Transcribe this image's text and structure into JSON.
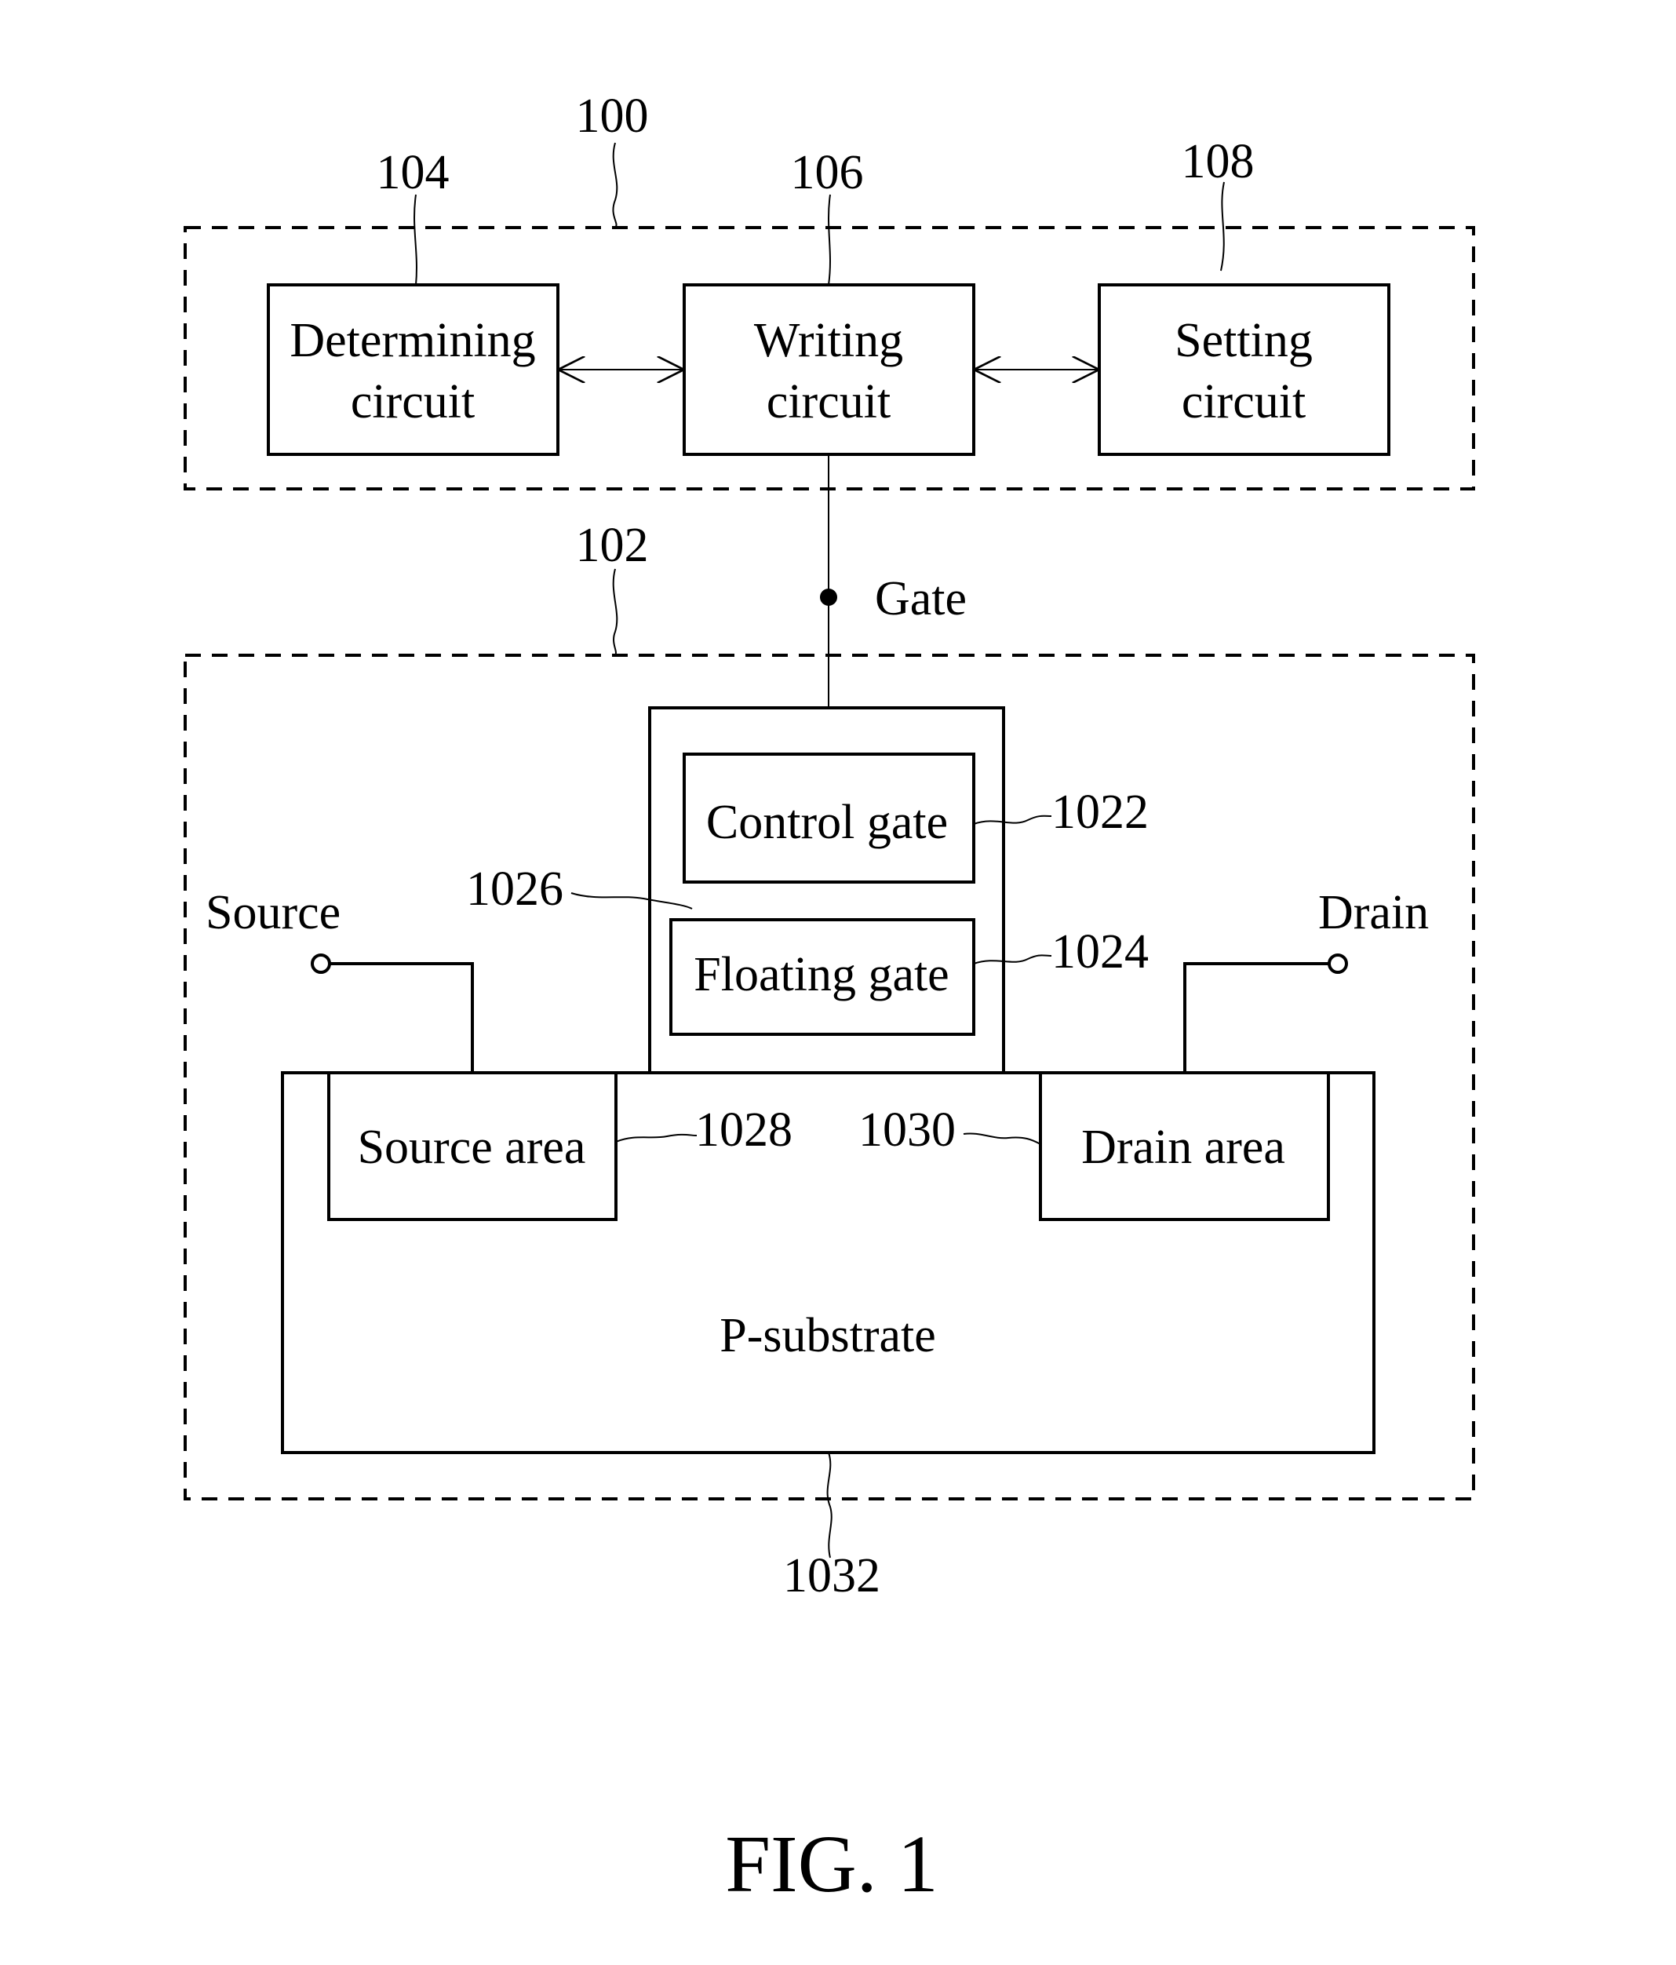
{
  "figure": {
    "caption": "FIG. 1",
    "reference_numerals": {
      "controller": "100",
      "memory_cell": "102",
      "determining": "104",
      "writing": "106",
      "setting": "108",
      "control_gate": "1022",
      "floating_gate": "1024",
      "dielectric": "1026",
      "source_area": "1028",
      "drain_area": "1030",
      "substrate": "1032"
    },
    "blocks": {
      "determining": [
        "Determining",
        "circuit"
      ],
      "writing": [
        "Writing",
        "circuit"
      ],
      "setting": [
        "Setting",
        "circuit"
      ]
    },
    "cell": {
      "control_gate": "Control gate",
      "floating_gate": "Floating gate",
      "source_area": "Source area",
      "drain_area": "Drain area",
      "substrate": "P-substrate"
    },
    "terminals": {
      "gate": "Gate",
      "source": "Source",
      "drain": "Drain"
    }
  }
}
